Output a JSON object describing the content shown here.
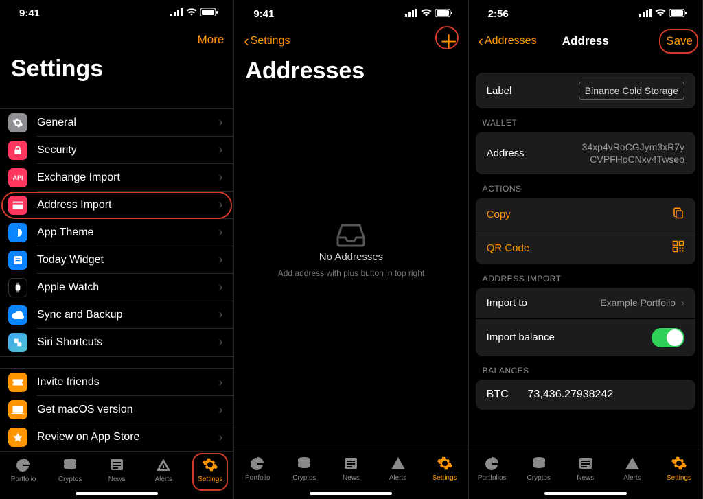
{
  "accent": "#ff9500",
  "screens": {
    "settings": {
      "time": "9:41",
      "more": "More",
      "title": "Settings",
      "items": [
        {
          "label": "General",
          "color": "#8e8e93",
          "icon": "gear"
        },
        {
          "label": "Security",
          "color": "#ff375f",
          "icon": "lock"
        },
        {
          "label": "Exchange Import",
          "color": "#ff375f",
          "icon": "api",
          "text_icon": "API"
        },
        {
          "label": "Address Import",
          "color": "#ff375f",
          "icon": "address",
          "highlighted": true
        },
        {
          "label": "App Theme",
          "color": "#0a84ff",
          "icon": "theme"
        },
        {
          "label": "Today Widget",
          "color": "#0a84ff",
          "icon": "widget"
        },
        {
          "label": "Apple Watch",
          "color": "#000000",
          "icon": "watch"
        },
        {
          "label": "Sync and Backup",
          "color": "#0a84ff",
          "icon": "cloud"
        },
        {
          "label": "Siri Shortcuts",
          "color": "#0a84ff",
          "icon": "siri"
        }
      ],
      "items2": [
        {
          "label": "Invite friends",
          "color": "#ff9500",
          "icon": "ticket"
        },
        {
          "label": "Get macOS version",
          "color": "#ff9500",
          "icon": "mac"
        },
        {
          "label": "Review on App Store",
          "color": "#ff9500",
          "icon": "star"
        }
      ]
    },
    "addresses": {
      "time": "9:41",
      "back": "Settings",
      "title": "Addresses",
      "empty_title": "No Addresses",
      "empty_sub": "Add address with plus button in top right"
    },
    "address": {
      "time": "2:56",
      "back": "Addresses",
      "title": "Address",
      "save": "Save",
      "label_field": "Label",
      "label_value": "Binance Cold Storage",
      "wallet_header": "WALLET",
      "address_label": "Address",
      "address_value_l1": "34xp4vRoCGJym3xR7y",
      "address_value_l2": "CVPFHoCNxv4Twseo",
      "actions_header": "ACTIONS",
      "copy": "Copy",
      "qr": "QR Code",
      "import_header": "ADDRESS IMPORT",
      "import_to_label": "Import to",
      "import_to_value": "Example Portfolio",
      "import_balance_label": "Import balance",
      "import_balance_on": true,
      "balances_header": "BALANCES",
      "balance_sym": "BTC",
      "balance_amt": "73,436.27938242"
    }
  },
  "tabs": {
    "s1": [
      "Portfolio",
      "Cryptos",
      "News",
      "Alerts",
      "Settings"
    ],
    "s3": [
      "Portfolios",
      "Cryptos",
      "News",
      "Alerts",
      "Settings"
    ]
  }
}
